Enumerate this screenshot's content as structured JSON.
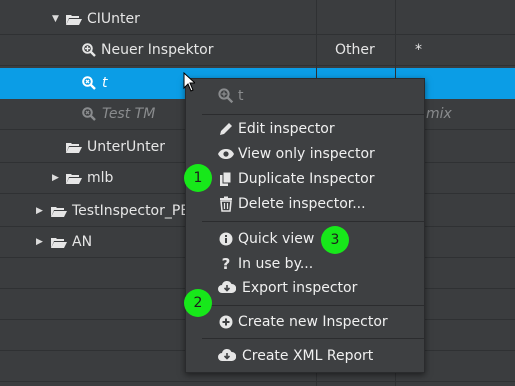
{
  "tree": {
    "rows": [
      {
        "label": "CIUnter"
      },
      {
        "label": "Neuer Inspektor",
        "col2": "Other",
        "col3": "*"
      },
      {
        "label": "t"
      },
      {
        "label": "Test TM",
        "col3_partial": "mix"
      },
      {
        "label": "UnterUnter"
      },
      {
        "label": "mlb"
      },
      {
        "label": "TestInspector_PE"
      },
      {
        "label": "AN"
      }
    ]
  },
  "context_menu": {
    "header": "t",
    "items": {
      "edit": "Edit inspector",
      "view_only": "View only inspector",
      "duplicate": "Duplicate Inspector",
      "delete": "Delete inspector...",
      "quick_view": "Quick view",
      "in_use": "In use by...",
      "export": "Export inspector",
      "create_new": "Create new Inspector",
      "xml_report": "Create XML Report"
    }
  },
  "badges": {
    "one": "1",
    "two": "2",
    "three": "3"
  },
  "colors": {
    "selection": "#0b9de6",
    "badge": "#17e81a",
    "background": "#3b3d3f",
    "menu": "#3e4042"
  },
  "icons": [
    "chevron-down-icon",
    "chevron-right-icon",
    "folder-open-icon",
    "inspector-icon",
    "pencil-icon",
    "eye-icon",
    "copy-icon",
    "trash-icon",
    "info-icon",
    "question-icon",
    "cloud-download-icon",
    "plus-circle-icon",
    "mouse-cursor-icon"
  ]
}
